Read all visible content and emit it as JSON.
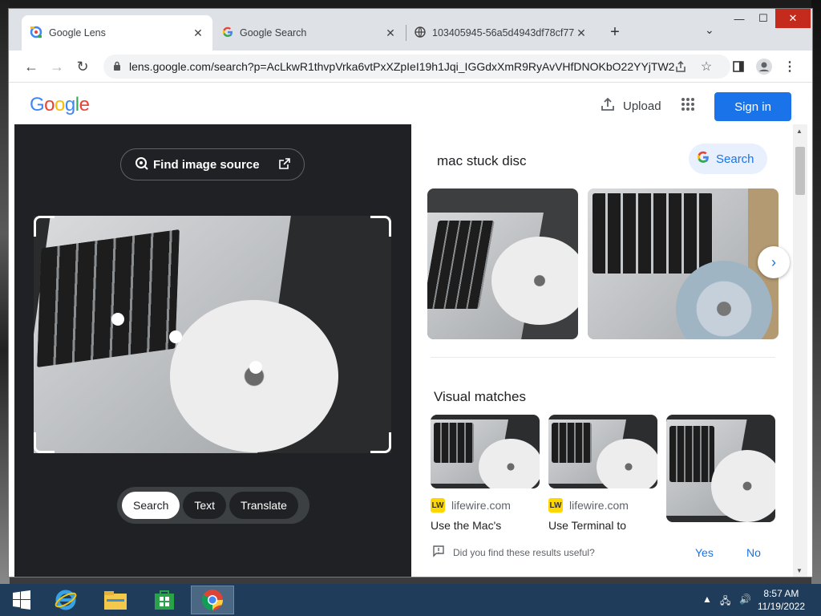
{
  "browser": {
    "tabs": [
      {
        "title": "Google Lens",
        "icon": "lens-icon",
        "active": true
      },
      {
        "title": "Google Search",
        "icon": "google-g-icon",
        "active": false
      },
      {
        "title": "103405945-56a5d4943df78cf772",
        "icon": "globe-icon",
        "active": false
      }
    ],
    "url": "lens.google.com/search?p=AcLkwR1thvpVrka6vtPxXZpIeI19h1Jqi_IGGdxXmR9RyAvVHfDNOKbO22YYjTW2..."
  },
  "header": {
    "logo": "Google",
    "upload_label": "Upload",
    "signin_label": "Sign in"
  },
  "lens": {
    "find_source_label": "Find image source",
    "modes": [
      {
        "label": "Search",
        "active": true
      },
      {
        "label": "Text",
        "active": false
      },
      {
        "label": "Translate",
        "active": false
      }
    ]
  },
  "results": {
    "query": "mac stuck disc",
    "search_label": "Search",
    "visual_matches_title": "Visual matches",
    "matches": [
      {
        "site": "lifewire.com",
        "desc": "Use the Mac's"
      },
      {
        "site": "lifewire.com",
        "desc": "Use Terminal to"
      },
      {
        "site": "",
        "desc": ""
      }
    ],
    "feedback_question": "Did you find these results useful?",
    "yes_label": "Yes",
    "no_label": "No"
  },
  "taskbar": {
    "time": "8:57 AM",
    "date": "11/19/2022"
  },
  "colors": {
    "accent": "#1a73e8",
    "lens_bg": "#202124",
    "taskbar": "#1f3c5a"
  }
}
